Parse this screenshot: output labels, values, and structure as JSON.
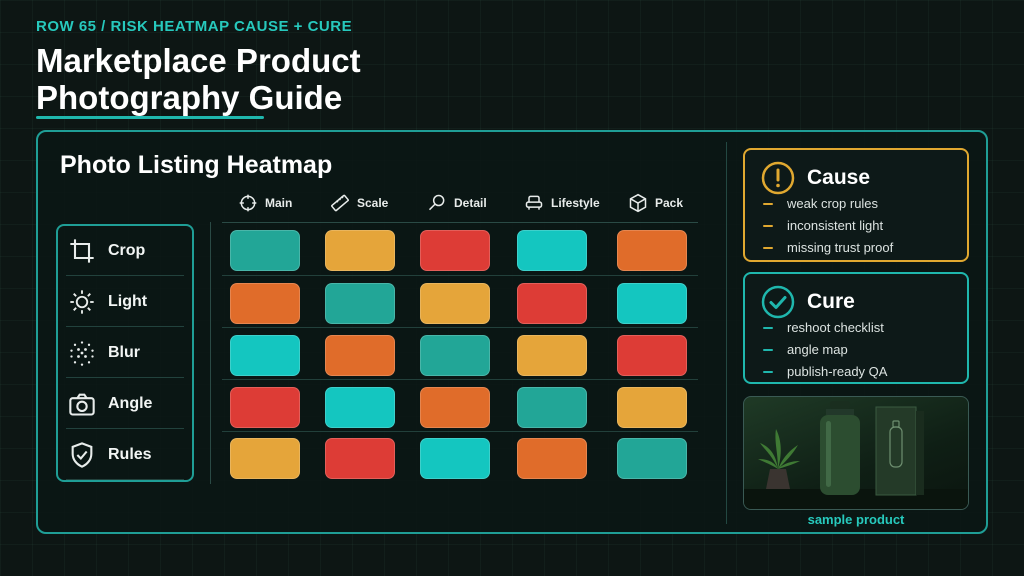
{
  "header": {
    "kicker": "ROW 65 / RISK HEATMAP CAUSE + CURE",
    "title_line1": "Marketplace Product",
    "title_line2": "Photography Guide"
  },
  "heatmap": {
    "title": "Photo Listing Heatmap",
    "columns": [
      {
        "label": "Main",
        "icon": "crosshair-icon"
      },
      {
        "label": "Scale",
        "icon": "ruler-icon"
      },
      {
        "label": "Detail",
        "icon": "magnifier-icon"
      },
      {
        "label": "Lifestyle",
        "icon": "armchair-icon"
      },
      {
        "label": "Pack",
        "icon": "box-icon"
      }
    ],
    "rows": [
      {
        "label": "Crop",
        "icon": "crop-icon"
      },
      {
        "label": "Light",
        "icon": "sun-icon"
      },
      {
        "label": "Blur",
        "icon": "blur-dots-icon"
      },
      {
        "label": "Angle",
        "icon": "camera-icon"
      },
      {
        "label": "Rules",
        "icon": "shield-check-icon"
      }
    ],
    "palette": {
      "teal": "#22a697",
      "amber": "#e5a53a",
      "red": "#dd3c36",
      "cyan": "#14c6c0",
      "orange": "#e06c2a"
    },
    "cells": [
      [
        "teal",
        "amber",
        "red",
        "cyan",
        "orange"
      ],
      [
        "orange",
        "teal",
        "amber",
        "red",
        "cyan"
      ],
      [
        "cyan",
        "orange",
        "teal",
        "amber",
        "red"
      ],
      [
        "red",
        "cyan",
        "orange",
        "teal",
        "amber"
      ],
      [
        "amber",
        "red",
        "cyan",
        "orange",
        "teal"
      ]
    ]
  },
  "cause": {
    "title": "Cause",
    "icon": "warning-circle-icon",
    "accent": "#e0a830",
    "items": [
      "weak crop rules",
      "inconsistent light",
      "missing trust proof"
    ]
  },
  "cure": {
    "title": "Cure",
    "icon": "check-circle-icon",
    "accent": "#1fb7ad",
    "items": [
      "reshoot checklist",
      "angle map",
      "publish-ready QA"
    ]
  },
  "sample": {
    "caption": "sample product"
  }
}
